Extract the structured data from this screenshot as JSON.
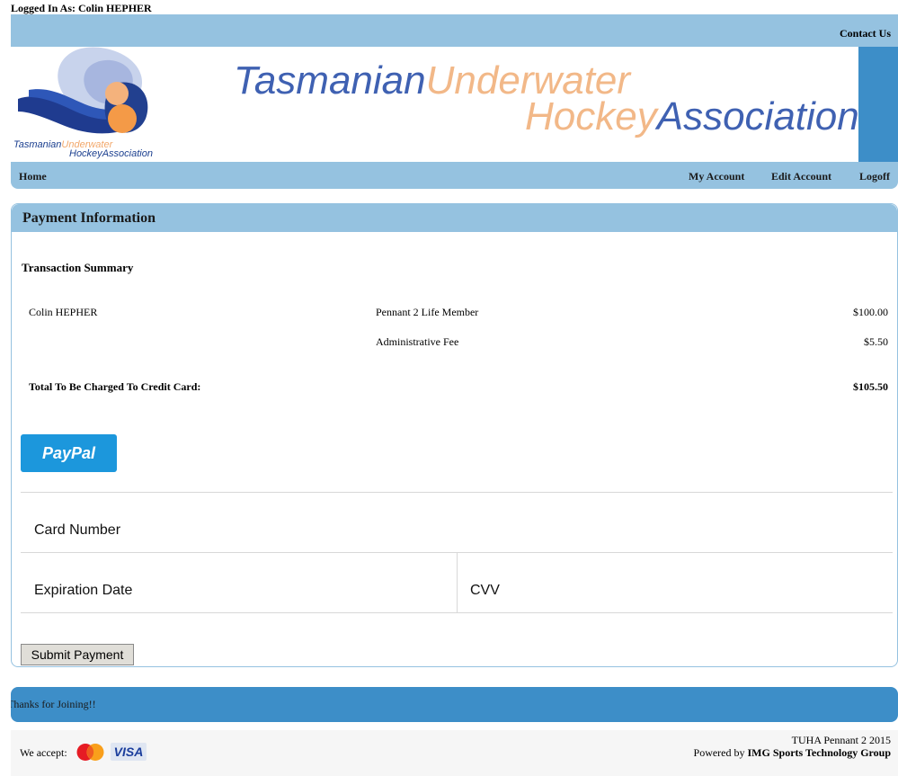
{
  "header": {
    "logged_in": "Logged In As: Colin HEPHER",
    "contact": "Contact Us",
    "logo_words": [
      "Tasmanian",
      "Underwater",
      "Hockey",
      "Association"
    ],
    "banner_words": [
      "Tasmanian",
      "Underwater",
      "Hockey",
      "Association"
    ]
  },
  "nav": {
    "home": "Home",
    "my_account": "My Account",
    "edit_account": "Edit Account",
    "logoff": "Logoff"
  },
  "panel": {
    "title": "Payment Information",
    "summary_title": "Transaction Summary",
    "rows": [
      {
        "name": "Colin HEPHER",
        "item": "Pennant 2 Life Member",
        "amount": "$100.00"
      },
      {
        "name": "",
        "item": "Administrative Fee",
        "amount": "$5.50"
      }
    ],
    "total_label": "Total To Be Charged To Credit Card:",
    "total_value": "$105.50",
    "paypal_label": "PayPal",
    "card_number": "Card Number",
    "expiration": "Expiration Date",
    "cvv": "CVV",
    "submit": "Submit Payment"
  },
  "footer": {
    "thanks": "Thanks for Joining!!",
    "we_accept": "We accept:",
    "visa": "VISA",
    "right_line1": "TUHA Pennant 2 2015",
    "powered_prefix": "Powered by ",
    "powered_brand": "IMG Sports Technology Group"
  },
  "colors": {
    "light_blue": "#95c2e0",
    "dark_blue": "#3d8ec8",
    "paypal": "#1c97dc",
    "navy_text": "#3f61b2",
    "peach_text": "#f2b888"
  }
}
